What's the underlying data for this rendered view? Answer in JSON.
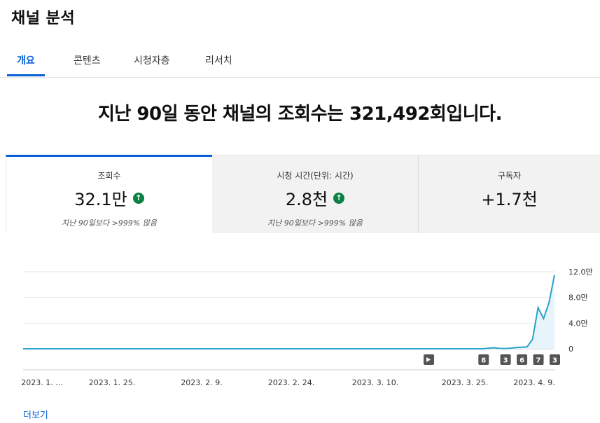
{
  "page": {
    "title": "채널 분석"
  },
  "tabs": [
    {
      "label": "개요",
      "active": true
    },
    {
      "label": "콘텐츠",
      "active": false
    },
    {
      "label": "시청자층",
      "active": false
    },
    {
      "label": "리서치",
      "active": false
    }
  ],
  "headline": "지난 90일 동안 채널의 조회수는 321,492회입니다.",
  "metrics": [
    {
      "label": "조회수",
      "value": "32.1만",
      "note": "지난 90일보다 >999% 많음",
      "trend_icon": "arrow-up-icon"
    },
    {
      "label": "시청 시간(단위: 시간)",
      "value": "2.8천",
      "note": "지난 90일보다 >999% 많음",
      "trend_icon": "arrow-up-icon"
    },
    {
      "label": "구독자",
      "value": "+1.7천"
    }
  ],
  "colors": {
    "accent": "#065fd4",
    "line": "#2aa2c9",
    "fill": "#e8f4fb",
    "up": "#0b8043"
  },
  "chart_data": {
    "type": "area",
    "x": [
      "2023. 1. ...",
      "2023. 1. 25.",
      "2023. 2. 9.",
      "2023. 2. 24.",
      "2023. 3. 10.",
      "2023. 3. 25.",
      "2023. 4. 9."
    ],
    "y_ticks": [
      "12.0만",
      "8.0만",
      "4.0만",
      "0"
    ],
    "ylim": [
      0,
      120000
    ],
    "values": [
      0,
      0,
      0,
      0,
      0,
      0,
      0,
      0,
      0,
      0,
      0,
      0,
      0,
      0,
      0,
      0,
      0,
      0,
      0,
      0,
      0,
      0,
      0,
      0,
      0,
      0,
      0,
      0,
      0,
      0,
      0,
      0,
      0,
      0,
      0,
      0,
      0,
      0,
      0,
      0,
      0,
      0,
      0,
      0,
      0,
      0,
      0,
      0,
      0,
      0,
      0,
      0,
      0,
      0,
      0,
      0,
      0,
      0,
      0,
      0,
      0,
      0,
      0,
      0,
      0,
      0,
      0,
      0,
      0,
      0,
      0,
      0,
      0,
      0,
      0,
      0,
      0,
      0,
      0,
      0,
      0,
      0,
      0,
      0,
      0,
      1000,
      1500,
      500,
      300,
      1000,
      2000,
      2500,
      3000,
      15000,
      64000,
      47000,
      72000,
      115000
    ],
    "markers": [
      {
        "label": "",
        "icon": "play-icon",
        "value_index": 74
      },
      {
        "label": "8",
        "value_index": 84
      },
      {
        "label": "3",
        "value_index": 88
      },
      {
        "label": "6",
        "value_index": 91
      },
      {
        "label": "7",
        "value_index": 94
      },
      {
        "label": "3",
        "value_index": 97
      }
    ]
  },
  "footer": {
    "more_label": "더보기"
  }
}
